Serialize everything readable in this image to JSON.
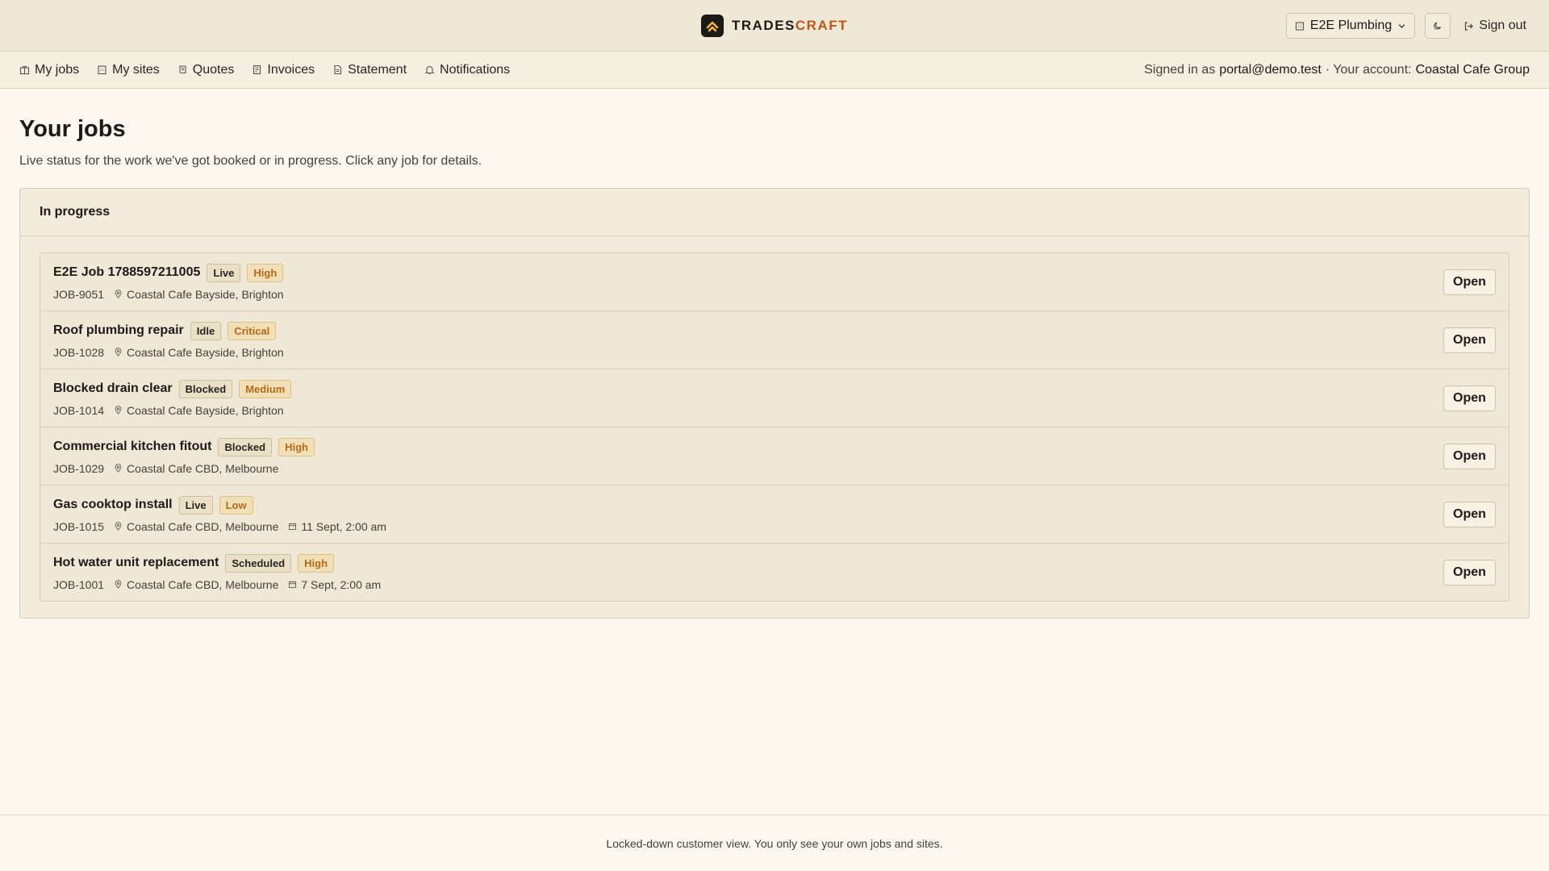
{
  "brand": {
    "name_part1": "TRADES",
    "name_part2": "CRAFT"
  },
  "header": {
    "org_selector": "E2E Plumbing",
    "sign_out": "Sign out"
  },
  "nav": {
    "items": [
      {
        "label": "My jobs",
        "icon": "briefcase-icon"
      },
      {
        "label": "My sites",
        "icon": "building-icon"
      },
      {
        "label": "Quotes",
        "icon": "scroll-icon"
      },
      {
        "label": "Invoices",
        "icon": "receipt-icon"
      },
      {
        "label": "Statement",
        "icon": "file-icon"
      },
      {
        "label": "Notifications",
        "icon": "bell-icon"
      }
    ],
    "signed_in_prefix": "Signed in as",
    "signed_in_email": "portal@demo.test",
    "account_prefix": "· Your account:",
    "account_name": "Coastal Cafe Group"
  },
  "main": {
    "title": "Your jobs",
    "subtitle": "Live status for the work we've got booked or in progress. Click any job for details.",
    "section_title": "In progress",
    "open_label": "Open",
    "jobs": [
      {
        "title": "E2E Job 1788597211005",
        "status": "Live",
        "priority": "High",
        "id": "JOB-9051",
        "site": "Coastal Cafe Bayside, Brighton",
        "date": ""
      },
      {
        "title": "Roof plumbing repair",
        "status": "Idle",
        "priority": "Critical",
        "id": "JOB-1028",
        "site": "Coastal Cafe Bayside, Brighton",
        "date": ""
      },
      {
        "title": "Blocked drain clear",
        "status": "Blocked",
        "priority": "Medium",
        "id": "JOB-1014",
        "site": "Coastal Cafe Bayside, Brighton",
        "date": ""
      },
      {
        "title": "Commercial kitchen fitout",
        "status": "Blocked",
        "priority": "High",
        "id": "JOB-1029",
        "site": "Coastal Cafe CBD, Melbourne",
        "date": ""
      },
      {
        "title": "Gas cooktop install",
        "status": "Live",
        "priority": "Low",
        "id": "JOB-1015",
        "site": "Coastal Cafe CBD, Melbourne",
        "date": "11 Sept, 2:00 am"
      },
      {
        "title": "Hot water unit replacement",
        "status": "Scheduled",
        "priority": "High",
        "id": "JOB-1001",
        "site": "Coastal Cafe CBD, Melbourne",
        "date": "7 Sept, 2:00 am"
      }
    ]
  },
  "footer": {
    "text": "Locked-down customer view. You only see your own jobs and sites."
  },
  "colors": {
    "accent": "#c2541a",
    "logo_bg": "#1c1917",
    "logo_fg": "#f5b53d",
    "priority_text": "#b56a1c"
  }
}
